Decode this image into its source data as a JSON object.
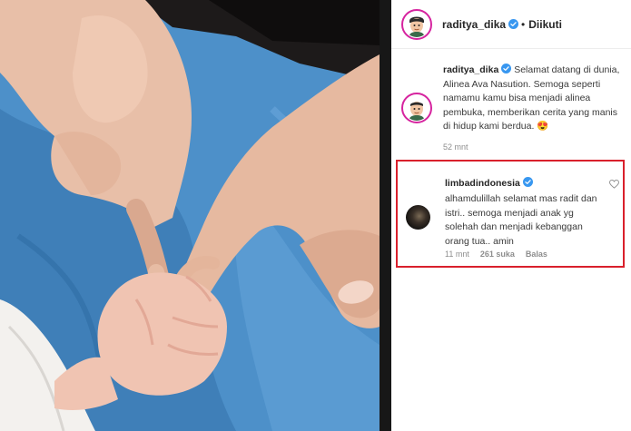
{
  "post": {
    "username": "raditya_dika",
    "follow_status": "Diikuti",
    "dot": "•"
  },
  "caption": {
    "username": "raditya_dika",
    "text": "Selamat datang di dunia, Alinea Ava Nasution. Semoga seperti namamu kamu bisa menjadi alinea pembuka, memberikan cerita yang manis di hidup kami berdua. 😍",
    "time": "52 mnt"
  },
  "comment": {
    "username": "limbadindonesia",
    "text": "alhamdulillah selamat mas radit dan istri.. semoga menjadi anak yg solehah dan menjadi kebanggan orang tua.. amin",
    "time": "11 mnt",
    "likes": "261 suka",
    "reply": "Balas"
  },
  "colors": {
    "verified": "#3897f0",
    "highlight_border": "#d9202c",
    "blanket": "#4a8ec7"
  },
  "icons": [
    "verified-badge-icon",
    "heart-icon"
  ]
}
